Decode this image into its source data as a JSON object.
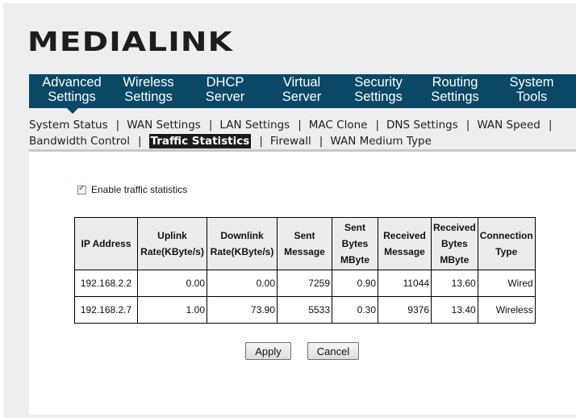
{
  "brand": {
    "logo_text": "MEDIALINK"
  },
  "nav": {
    "items": [
      {
        "line1": "Advanced",
        "line2": "Settings"
      },
      {
        "line1": "Wireless",
        "line2": "Settings"
      },
      {
        "line1": "DHCP",
        "line2": "Server"
      },
      {
        "line1": "Virtual",
        "line2": "Server"
      },
      {
        "line1": "Security",
        "line2": "Settings"
      },
      {
        "line1": "Routing",
        "line2": "Settings"
      },
      {
        "line1": "System",
        "line2": "Tools"
      }
    ],
    "active_index": 0
  },
  "subnav": {
    "row1": [
      "System Status",
      "WAN Settings",
      "LAN Settings",
      "MAC Clone",
      "DNS Settings",
      "WAN Speed"
    ],
    "row2": [
      "Bandwidth Control",
      "Traffic Statistics",
      "Firewall",
      "WAN Medium Type"
    ],
    "separator": "|",
    "active": "Traffic Statistics"
  },
  "enable_checkbox": {
    "label": "Enable traffic statistics",
    "checked": true
  },
  "table": {
    "headers": [
      [
        "IP Address"
      ],
      [
        "Uplink",
        "Rate(KByte/s)"
      ],
      [
        "Downlink",
        "Rate(KByte/s)"
      ],
      [
        "Sent",
        "Message"
      ],
      [
        "Sent",
        "Bytes",
        "MByte"
      ],
      [
        "Received",
        "Message"
      ],
      [
        "Received",
        "Bytes",
        "MByte"
      ],
      [
        "Connection",
        "Type"
      ]
    ],
    "rows": [
      [
        "192.168.2.2",
        "0.00",
        "0.00",
        "7259",
        "0.90",
        "11044",
        "13.60",
        "Wired"
      ],
      [
        "192.168.2.7",
        "1.00",
        "73.90",
        "5533",
        "0.30",
        "9376",
        "13.40",
        "Wireless"
      ]
    ]
  },
  "buttons": {
    "apply": "Apply",
    "cancel": "Cancel"
  }
}
